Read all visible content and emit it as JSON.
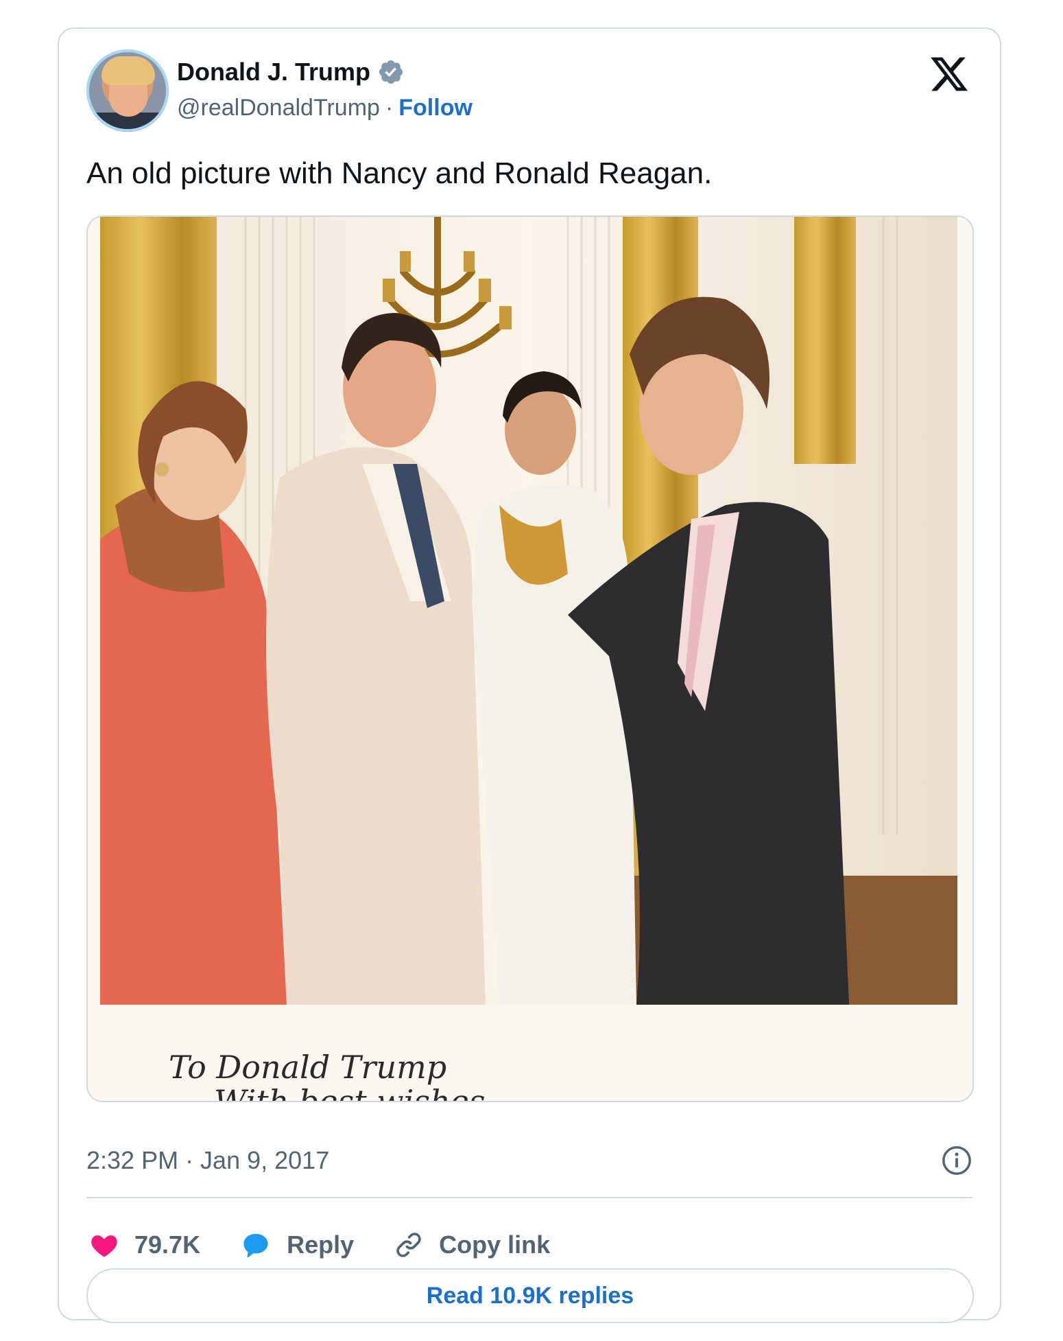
{
  "author": {
    "name": "Donald J. Trump",
    "handle": "@realDonaldTrump",
    "separator": "·",
    "follow_label": "Follow",
    "verified_icon": "verified-badge-icon",
    "verified_color": "#829aab"
  },
  "platform_icon": "x-logo-icon",
  "tweet": {
    "text": "An old picture with Nancy and Ronald Reagan."
  },
  "photo": {
    "inscription_line1": "To Donald Trump",
    "inscription_line2": "With best wishes,"
  },
  "meta": {
    "timestamp": "2:32 PM · Jan 9, 2017",
    "info_icon": "info-icon"
  },
  "actions": {
    "like_count": "79.7K",
    "like_color": "#f91880",
    "reply_label": "Reply",
    "reply_color": "#1d9bf0",
    "copy_link_label": "Copy link"
  },
  "read_replies_label": "Read 10.9K replies",
  "colors": {
    "link": "#1d70c8",
    "muted": "#536471",
    "border": "#cfd9de"
  }
}
